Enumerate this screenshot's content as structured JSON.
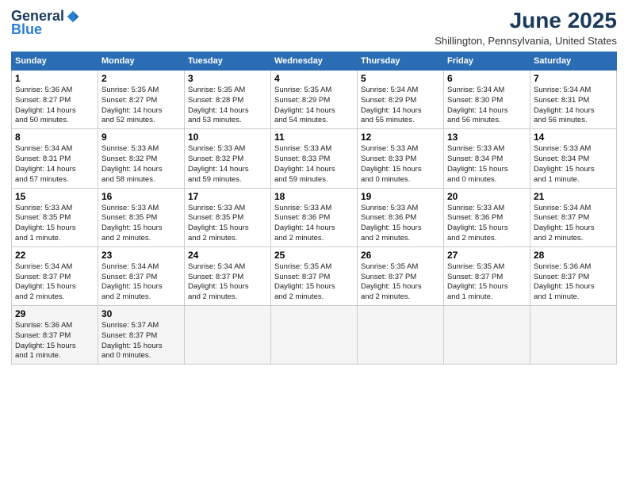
{
  "logo": {
    "general": "General",
    "blue": "Blue"
  },
  "title": "June 2025",
  "location": "Shillington, Pennsylvania, United States",
  "days_of_week": [
    "Sunday",
    "Monday",
    "Tuesday",
    "Wednesday",
    "Thursday",
    "Friday",
    "Saturday"
  ],
  "weeks": [
    [
      {
        "day": 1,
        "info": "Sunrise: 5:36 AM\nSunset: 8:27 PM\nDaylight: 14 hours\nand 50 minutes."
      },
      {
        "day": 2,
        "info": "Sunrise: 5:35 AM\nSunset: 8:27 PM\nDaylight: 14 hours\nand 52 minutes."
      },
      {
        "day": 3,
        "info": "Sunrise: 5:35 AM\nSunset: 8:28 PM\nDaylight: 14 hours\nand 53 minutes."
      },
      {
        "day": 4,
        "info": "Sunrise: 5:35 AM\nSunset: 8:29 PM\nDaylight: 14 hours\nand 54 minutes."
      },
      {
        "day": 5,
        "info": "Sunrise: 5:34 AM\nSunset: 8:29 PM\nDaylight: 14 hours\nand 55 minutes."
      },
      {
        "day": 6,
        "info": "Sunrise: 5:34 AM\nSunset: 8:30 PM\nDaylight: 14 hours\nand 56 minutes."
      },
      {
        "day": 7,
        "info": "Sunrise: 5:34 AM\nSunset: 8:31 PM\nDaylight: 14 hours\nand 56 minutes."
      }
    ],
    [
      {
        "day": 8,
        "info": "Sunrise: 5:34 AM\nSunset: 8:31 PM\nDaylight: 14 hours\nand 57 minutes."
      },
      {
        "day": 9,
        "info": "Sunrise: 5:33 AM\nSunset: 8:32 PM\nDaylight: 14 hours\nand 58 minutes."
      },
      {
        "day": 10,
        "info": "Sunrise: 5:33 AM\nSunset: 8:32 PM\nDaylight: 14 hours\nand 59 minutes."
      },
      {
        "day": 11,
        "info": "Sunrise: 5:33 AM\nSunset: 8:33 PM\nDaylight: 14 hours\nand 59 minutes."
      },
      {
        "day": 12,
        "info": "Sunrise: 5:33 AM\nSunset: 8:33 PM\nDaylight: 15 hours\nand 0 minutes."
      },
      {
        "day": 13,
        "info": "Sunrise: 5:33 AM\nSunset: 8:34 PM\nDaylight: 15 hours\nand 0 minutes."
      },
      {
        "day": 14,
        "info": "Sunrise: 5:33 AM\nSunset: 8:34 PM\nDaylight: 15 hours\nand 1 minute."
      }
    ],
    [
      {
        "day": 15,
        "info": "Sunrise: 5:33 AM\nSunset: 8:35 PM\nDaylight: 15 hours\nand 1 minute."
      },
      {
        "day": 16,
        "info": "Sunrise: 5:33 AM\nSunset: 8:35 PM\nDaylight: 15 hours\nand 2 minutes."
      },
      {
        "day": 17,
        "info": "Sunrise: 5:33 AM\nSunset: 8:35 PM\nDaylight: 15 hours\nand 2 minutes."
      },
      {
        "day": 18,
        "info": "Sunrise: 5:33 AM\nSunset: 8:36 PM\nDaylight: 14 hours\nand 2 minutes."
      },
      {
        "day": 19,
        "info": "Sunrise: 5:33 AM\nSunset: 8:36 PM\nDaylight: 15 hours\nand 2 minutes."
      },
      {
        "day": 20,
        "info": "Sunrise: 5:33 AM\nSunset: 8:36 PM\nDaylight: 15 hours\nand 2 minutes."
      },
      {
        "day": 21,
        "info": "Sunrise: 5:34 AM\nSunset: 8:37 PM\nDaylight: 15 hours\nand 2 minutes."
      }
    ],
    [
      {
        "day": 22,
        "info": "Sunrise: 5:34 AM\nSunset: 8:37 PM\nDaylight: 15 hours\nand 2 minutes."
      },
      {
        "day": 23,
        "info": "Sunrise: 5:34 AM\nSunset: 8:37 PM\nDaylight: 15 hours\nand 2 minutes."
      },
      {
        "day": 24,
        "info": "Sunrise: 5:34 AM\nSunset: 8:37 PM\nDaylight: 15 hours\nand 2 minutes."
      },
      {
        "day": 25,
        "info": "Sunrise: 5:35 AM\nSunset: 8:37 PM\nDaylight: 15 hours\nand 2 minutes."
      },
      {
        "day": 26,
        "info": "Sunrise: 5:35 AM\nSunset: 8:37 PM\nDaylight: 15 hours\nand 2 minutes."
      },
      {
        "day": 27,
        "info": "Sunrise: 5:35 AM\nSunset: 8:37 PM\nDaylight: 15 hours\nand 1 minute."
      },
      {
        "day": 28,
        "info": "Sunrise: 5:36 AM\nSunset: 8:37 PM\nDaylight: 15 hours\nand 1 minute."
      }
    ],
    [
      {
        "day": 29,
        "info": "Sunrise: 5:36 AM\nSunset: 8:37 PM\nDaylight: 15 hours\nand 1 minute."
      },
      {
        "day": 30,
        "info": "Sunrise: 5:37 AM\nSunset: 8:37 PM\nDaylight: 15 hours\nand 0 minutes."
      },
      {
        "day": null,
        "info": ""
      },
      {
        "day": null,
        "info": ""
      },
      {
        "day": null,
        "info": ""
      },
      {
        "day": null,
        "info": ""
      },
      {
        "day": null,
        "info": ""
      }
    ]
  ]
}
